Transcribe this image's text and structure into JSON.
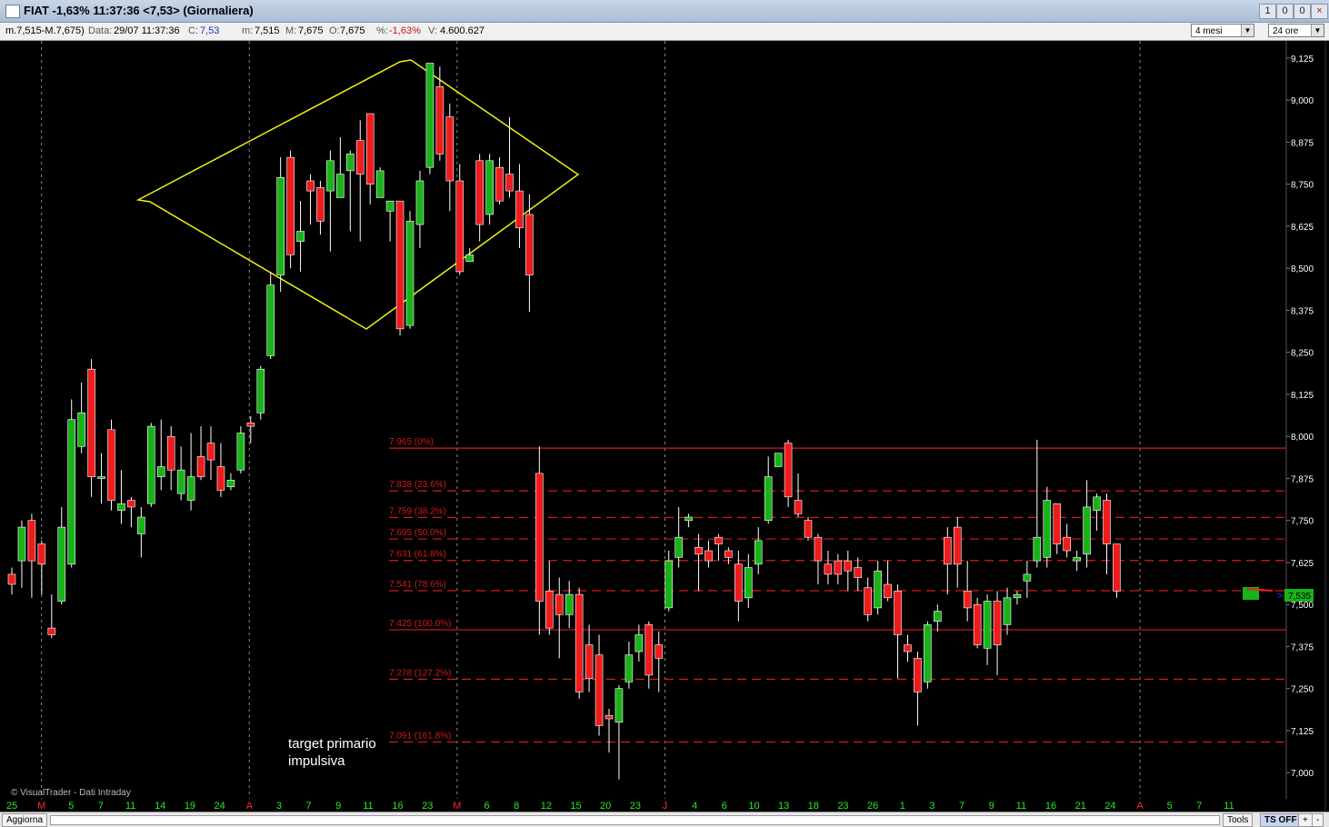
{
  "window": {
    "title": "FIAT -1,63% 11:37:36  <7,53> (Giornaliera)",
    "controls": [
      "1",
      "0",
      "×"
    ]
  },
  "infobar": {
    "range": "m.7,515-M.7,675)",
    "data_label": "Data:",
    "data_value": "29/07 11:37:36",
    "c_label": "C:",
    "c_value": "7,53",
    "m_label": "m:",
    "m_value": "7,515",
    "M_label": "M:",
    "M_value": "7,675",
    "o_label": "O:",
    "o_value": "7,675",
    "pct_label": "%:",
    "pct_value": "-1,63%",
    "v_label": "V:",
    "v_value": "4.600.627",
    "period_select": "4 mesi",
    "interval_select": "24 ore"
  },
  "bottom": {
    "update_button": "Aggiorna",
    "tools_button": "Tools",
    "tsoff_button": "TS OFF",
    "plus_button": "+",
    "minus_button": "-"
  },
  "chart_data": {
    "type": "candlestick",
    "watermark": "© VisualTrader - Dati Intraday",
    "ylim": [
      6.96,
      9.16
    ],
    "y_ticks": [
      "9,125",
      "9,000",
      "8,875",
      "8,750",
      "8,625",
      "8,500",
      "8,375",
      "8,250",
      "8,125",
      "8,000",
      "7,875",
      "7,750",
      "7,625",
      "7,500",
      "7,375",
      "7,250",
      "7,125",
      "7,000"
    ],
    "x_ticks": [
      {
        "label": "25",
        "month": false
      },
      {
        "label": "M",
        "month": true
      },
      {
        "label": "5",
        "month": false
      },
      {
        "label": "7",
        "month": false
      },
      {
        "label": "11",
        "month": false
      },
      {
        "label": "14",
        "month": false
      },
      {
        "label": "19",
        "month": false
      },
      {
        "label": "24",
        "month": false
      },
      {
        "label": "A",
        "month": true
      },
      {
        "label": "3",
        "month": false
      },
      {
        "label": "7",
        "month": false
      },
      {
        "label": "9",
        "month": false
      },
      {
        "label": "11",
        "month": false
      },
      {
        "label": "16",
        "month": false
      },
      {
        "label": "23",
        "month": false
      },
      {
        "label": "M",
        "month": true
      },
      {
        "label": "6",
        "month": false
      },
      {
        "label": "8",
        "month": false
      },
      {
        "label": "12",
        "month": false
      },
      {
        "label": "15",
        "month": false
      },
      {
        "label": "20",
        "month": false
      },
      {
        "label": "23",
        "month": false
      },
      {
        "label": "J",
        "month": true
      },
      {
        "label": "4",
        "month": false
      },
      {
        "label": "6",
        "month": false
      },
      {
        "label": "10",
        "month": false
      },
      {
        "label": "13",
        "month": false
      },
      {
        "label": "18",
        "month": false
      },
      {
        "label": "23",
        "month": false
      },
      {
        "label": "26",
        "month": false
      },
      {
        "label": "1",
        "month": false
      },
      {
        "label": "3",
        "month": false
      },
      {
        "label": "7",
        "month": false
      },
      {
        "label": "9",
        "month": false
      },
      {
        "label": "11",
        "month": false
      },
      {
        "label": "16",
        "month": false
      },
      {
        "label": "21",
        "month": false
      },
      {
        "label": "24",
        "month": false
      },
      {
        "label": "A",
        "month": true
      },
      {
        "label": "5",
        "month": false
      },
      {
        "label": "7",
        "month": false
      },
      {
        "label": "11",
        "month": false
      }
    ],
    "candles": [
      [
        7.59,
        7.56,
        7.61,
        7.53
      ],
      [
        7.63,
        7.73,
        7.75,
        7.55
      ],
      [
        7.75,
        7.63,
        7.77,
        7.52
      ],
      [
        7.68,
        7.62,
        7.69,
        7.53
      ],
      [
        7.43,
        7.41,
        7.53,
        7.4
      ],
      [
        7.51,
        7.73,
        7.79,
        7.5
      ],
      [
        7.62,
        8.05,
        8.11,
        7.61
      ],
      [
        7.97,
        8.07,
        8.16,
        7.95
      ],
      [
        8.2,
        7.88,
        8.23,
        7.82
      ],
      [
        7.88,
        7.88,
        7.95,
        7.8
      ],
      [
        8.02,
        7.81,
        8.05,
        7.78
      ],
      [
        7.78,
        7.8,
        7.9,
        7.74
      ],
      [
        7.81,
        7.79,
        7.82,
        7.73
      ],
      [
        7.71,
        7.76,
        7.79,
        7.64
      ],
      [
        7.8,
        8.03,
        8.04,
        7.79
      ],
      [
        7.88,
        7.91,
        8.05,
        7.84
      ],
      [
        8.0,
        7.9,
        8.03,
        7.84
      ],
      [
        7.83,
        7.9,
        7.97,
        7.81
      ],
      [
        7.81,
        7.88,
        8.01,
        7.78
      ],
      [
        7.94,
        7.88,
        8.03,
        7.87
      ],
      [
        7.98,
        7.93,
        8.03,
        7.87
      ],
      [
        7.91,
        7.84,
        7.98,
        7.82
      ],
      [
        7.85,
        7.87,
        7.89,
        7.84
      ],
      [
        7.9,
        8.01,
        8.03,
        7.89
      ],
      [
        8.04,
        8.03,
        8.06,
        7.98
      ],
      [
        8.07,
        8.2,
        8.21,
        8.05
      ],
      [
        8.24,
        8.45,
        8.49,
        8.23
      ],
      [
        8.48,
        8.77,
        8.83,
        8.43
      ],
      [
        8.83,
        8.54,
        8.85,
        8.5
      ],
      [
        8.58,
        8.61,
        8.7,
        8.49
      ],
      [
        8.76,
        8.73,
        8.78,
        8.63
      ],
      [
        8.74,
        8.64,
        8.76,
        8.6
      ],
      [
        8.73,
        8.82,
        8.85,
        8.55
      ],
      [
        8.71,
        8.78,
        8.89,
        8.71
      ],
      [
        8.79,
        8.84,
        8.85,
        8.61
      ],
      [
        8.88,
        8.78,
        8.94,
        8.58
      ],
      [
        8.96,
        8.75,
        8.96,
        8.69
      ],
      [
        8.71,
        8.79,
        8.8,
        8.71
      ],
      [
        8.67,
        8.7,
        8.7,
        8.58
      ],
      [
        8.7,
        8.32,
        8.7,
        8.3
      ],
      [
        8.33,
        8.64,
        8.67,
        8.32
      ],
      [
        8.63,
        8.76,
        8.79,
        8.56
      ],
      [
        8.8,
        9.11,
        9.11,
        8.78
      ],
      [
        9.04,
        8.84,
        9.1,
        8.82
      ],
      [
        8.95,
        8.76,
        8.99,
        8.67
      ],
      [
        8.76,
        8.49,
        8.81,
        8.48
      ],
      [
        8.52,
        8.54,
        8.56,
        8.52
      ],
      [
        8.82,
        8.63,
        8.84,
        8.58
      ],
      [
        8.66,
        8.82,
        8.84,
        8.63
      ],
      [
        8.8,
        8.7,
        8.83,
        8.69
      ],
      [
        8.78,
        8.73,
        8.95,
        8.71
      ],
      [
        8.73,
        8.62,
        8.81,
        8.56
      ],
      [
        8.66,
        8.48,
        8.72,
        8.37
      ],
      [
        7.89,
        7.51,
        7.97,
        7.41
      ],
      [
        7.54,
        7.43,
        7.63,
        7.41
      ],
      [
        7.53,
        7.47,
        7.58,
        7.34
      ],
      [
        7.47,
        7.53,
        7.57,
        7.43
      ],
      [
        7.53,
        7.24,
        7.55,
        7.22
      ],
      [
        7.38,
        7.28,
        7.44,
        7.24
      ],
      [
        7.35,
        7.14,
        7.41,
        7.11
      ],
      [
        7.17,
        7.16,
        7.19,
        7.06
      ],
      [
        7.15,
        7.25,
        7.26,
        6.98
      ],
      [
        7.27,
        7.35,
        7.39,
        7.25
      ],
      [
        7.36,
        7.41,
        7.44,
        7.33
      ],
      [
        7.44,
        7.29,
        7.45,
        7.25
      ],
      [
        7.38,
        7.34,
        7.42,
        7.24
      ],
      [
        7.49,
        7.63,
        7.66,
        7.48
      ],
      [
        7.64,
        7.7,
        7.79,
        7.61
      ],
      [
        7.75,
        7.76,
        7.77,
        7.73
      ],
      [
        7.67,
        7.65,
        7.71,
        7.54
      ],
      [
        7.66,
        7.63,
        7.69,
        7.61
      ],
      [
        7.7,
        7.68,
        7.71,
        7.63
      ],
      [
        7.66,
        7.64,
        7.67,
        7.62
      ],
      [
        7.62,
        7.51,
        7.66,
        7.45
      ],
      [
        7.52,
        7.61,
        7.65,
        7.49
      ],
      [
        7.62,
        7.69,
        7.73,
        7.59
      ],
      [
        7.75,
        7.88,
        7.94,
        7.74
      ],
      [
        7.91,
        7.95,
        7.95,
        7.92
      ],
      [
        7.98,
        7.82,
        7.99,
        7.79
      ],
      [
        7.81,
        7.77,
        7.89,
        7.76
      ],
      [
        7.75,
        7.7,
        7.76,
        7.69
      ],
      [
        7.7,
        7.63,
        7.71,
        7.56
      ],
      [
        7.62,
        7.59,
        7.66,
        7.56
      ],
      [
        7.63,
        7.59,
        7.65,
        7.56
      ],
      [
        7.63,
        7.6,
        7.66,
        7.54
      ],
      [
        7.61,
        7.58,
        7.64,
        7.54
      ],
      [
        7.55,
        7.47,
        7.58,
        7.45
      ],
      [
        7.49,
        7.6,
        7.63,
        7.47
      ],
      [
        7.56,
        7.52,
        7.63,
        7.51
      ],
      [
        7.54,
        7.41,
        7.56,
        7.28
      ],
      [
        7.38,
        7.36,
        7.41,
        7.33
      ],
      [
        7.34,
        7.24,
        7.36,
        7.14
      ],
      [
        7.27,
        7.44,
        7.45,
        7.25
      ],
      [
        7.45,
        7.48,
        7.5,
        7.42
      ],
      [
        7.7,
        7.62,
        7.73,
        7.53
      ],
      [
        7.73,
        7.62,
        7.76,
        7.55
      ],
      [
        7.54,
        7.49,
        7.63,
        7.45
      ],
      [
        7.5,
        7.38,
        7.52,
        7.37
      ],
      [
        7.37,
        7.51,
        7.53,
        7.32
      ],
      [
        7.51,
        7.38,
        7.54,
        7.29
      ],
      [
        7.44,
        7.52,
        7.55,
        7.41
      ],
      [
        7.52,
        7.53,
        7.54,
        7.5
      ],
      [
        7.57,
        7.59,
        7.63,
        7.52
      ],
      [
        7.63,
        7.7,
        7.99,
        7.61
      ],
      [
        7.64,
        7.81,
        7.85,
        7.61
      ],
      [
        7.8,
        7.68,
        7.8,
        7.65
      ],
      [
        7.7,
        7.66,
        7.74,
        7.64
      ],
      [
        7.63,
        7.64,
        7.66,
        7.6
      ],
      [
        7.65,
        7.79,
        7.87,
        7.61
      ],
      [
        7.78,
        7.82,
        7.83,
        7.72
      ],
      [
        7.81,
        7.68,
        7.83,
        7.59
      ],
      [
        7.68,
        7.54,
        7.68,
        7.52
      ]
    ],
    "fibonacci": [
      {
        "label": "7.965 (0%)",
        "value": 7.965,
        "style": "solid"
      },
      {
        "label": "7.838 (23.6%)",
        "value": 7.838,
        "style": "dashed"
      },
      {
        "label": "7.759 (38.2%)",
        "value": 7.759,
        "style": "dashed"
      },
      {
        "label": "7.695 (50.0%)",
        "value": 7.695,
        "style": "dashed"
      },
      {
        "label": "7.631 (61.8%)",
        "value": 7.631,
        "style": "dashed"
      },
      {
        "label": "7.541 (78.6%)",
        "value": 7.541,
        "style": "dashed"
      },
      {
        "label": "7.425 (100.0%)",
        "value": 7.425,
        "style": "solid"
      },
      {
        "label": "7.278 (127.2%)",
        "value": 7.278,
        "style": "dashed"
      },
      {
        "label": "7.091 (161.8%)",
        "value": 7.091,
        "style": "dashed"
      }
    ],
    "annotation": [
      "target primario",
      "impulsiva"
    ],
    "price_marker": "7,535",
    "colors": {
      "up": "#19b319",
      "down": "#ee1c1c",
      "fib": "#d21b1b",
      "pattern": "#f2f20f",
      "axis_text": "#ffffff",
      "month_text": "#ff2a2a",
      "day_text": "#22ee22"
    }
  }
}
